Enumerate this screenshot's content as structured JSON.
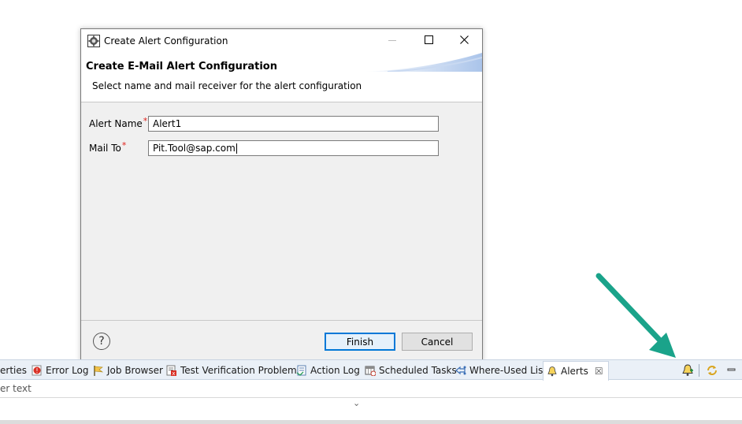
{
  "dialog": {
    "window_title": "Create Alert Configuration",
    "header_title": "Create E-Mail Alert Configuration",
    "header_description": "Select name and mail receiver for the alert configuration",
    "fields": [
      {
        "label": "Alert Name",
        "required_mark": "*",
        "value": "Alert1"
      },
      {
        "label": "Mail To",
        "required_mark": "*",
        "value": "Pit.Tool@sap.com"
      }
    ],
    "help_label": "?",
    "finish_label": "Finish",
    "cancel_label": "Cancel"
  },
  "bottom_panel": {
    "tabs": [
      {
        "label": "erties",
        "icon": "properties-icon"
      },
      {
        "label": "Error Log",
        "icon": "error-log-icon"
      },
      {
        "label": "Job Browser",
        "icon": "flag-icon"
      },
      {
        "label": "Test Verification Problems",
        "icon": "test-problems-icon"
      },
      {
        "label": "Action Log",
        "icon": "action-log-icon"
      },
      {
        "label": "Scheduled Tasks",
        "icon": "calendar-icon"
      },
      {
        "label": "Where-Used List",
        "icon": "where-used-icon"
      },
      {
        "label": "Alerts",
        "icon": "bell-icon",
        "active": true,
        "close": "☒"
      }
    ],
    "filter_text": "er text",
    "toolbar_icons": [
      "add-alert-bell-icon",
      "refresh-icon",
      "minimize-icon"
    ]
  },
  "colors": {
    "arrow": "#1aa38a",
    "accent_blue": "#0078d7",
    "required_red": "#e0201a",
    "tabbar_bg": "#eaf0f7"
  }
}
